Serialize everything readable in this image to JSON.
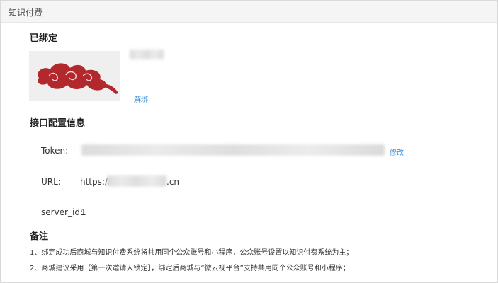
{
  "header": {
    "title": "知识付费"
  },
  "bound": {
    "title": "已绑定",
    "unbind_label": "解绑",
    "logo_color": "#b3282d"
  },
  "interface": {
    "title": "接口配置信息",
    "token": {
      "label": "Token:",
      "edit_label": "修改"
    },
    "url": {
      "label": "URL:",
      "prefix": "https://",
      "suffix": ".cn"
    },
    "server_id": {
      "label": "server_id:",
      "value": "1"
    }
  },
  "notes": {
    "title": "备注",
    "items": [
      "1、绑定成功后商城与知识付费系统将共用同个公众账号和小程序，公众账号设置以知识付费系统为主；",
      "2、商城建议采用【第一次邀请人锁定】，绑定后商城与“微云视平台”支持共用同个公众账号和小程序；"
    ]
  }
}
